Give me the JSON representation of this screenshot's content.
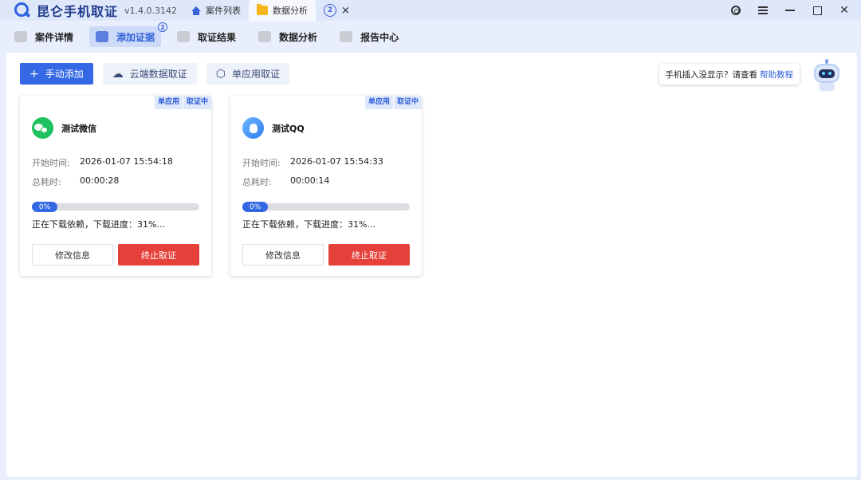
{
  "app": {
    "title": "昆仑手机取证",
    "version": "v1.4.0.3142"
  },
  "tabs": [
    {
      "label": "案件列表",
      "icon": "home-icon"
    },
    {
      "label": "数据分析",
      "icon": "folder-icon",
      "active": true
    },
    {
      "label": "",
      "badge": "2",
      "close": "×"
    }
  ],
  "window_controls": [
    "settings-icon",
    "menu-icon",
    "minimize-icon",
    "maximize-icon",
    "close-icon"
  ],
  "window_close_glyph": "✕",
  "nav": [
    {
      "label": "案件详情"
    },
    {
      "label": "添加证据",
      "active": true,
      "badge": "2"
    },
    {
      "label": "取证结果"
    },
    {
      "label": "数据分析"
    },
    {
      "label": "报告中心"
    }
  ],
  "actions": {
    "manual_add": "手动添加",
    "cloud": "云端数据取证",
    "single_app": "单应用取证"
  },
  "help": {
    "text": "手机插入没显示？请查看",
    "link": "帮助教程"
  },
  "cards": [
    {
      "tag1": "单应用",
      "tag2": "取证中",
      "app": "测试微信",
      "start_label": "开始时间:",
      "start_value": "2026-01-07 15:54:18",
      "elapsed_label": "总耗时:",
      "elapsed_value": "00:00:28",
      "progress_text": "0%",
      "progress": 0,
      "status": "正在下载依赖，下载进度：31%...",
      "edit": "修改信息",
      "stop": "终止取证"
    },
    {
      "tag1": "单应用",
      "tag2": "取证中",
      "app": "测试QQ",
      "start_label": "开始时间:",
      "start_value": "2026-01-07 15:54:33",
      "elapsed_label": "总耗时:",
      "elapsed_value": "00:00:14",
      "progress_text": "0%",
      "progress": 0,
      "status": "正在下载依赖，下载进度：31%...",
      "edit": "修改信息",
      "stop": "终止取证"
    }
  ],
  "colors": {
    "primary": "#3468e4",
    "danger": "#e5413a",
    "wechat": "#1fc160"
  }
}
